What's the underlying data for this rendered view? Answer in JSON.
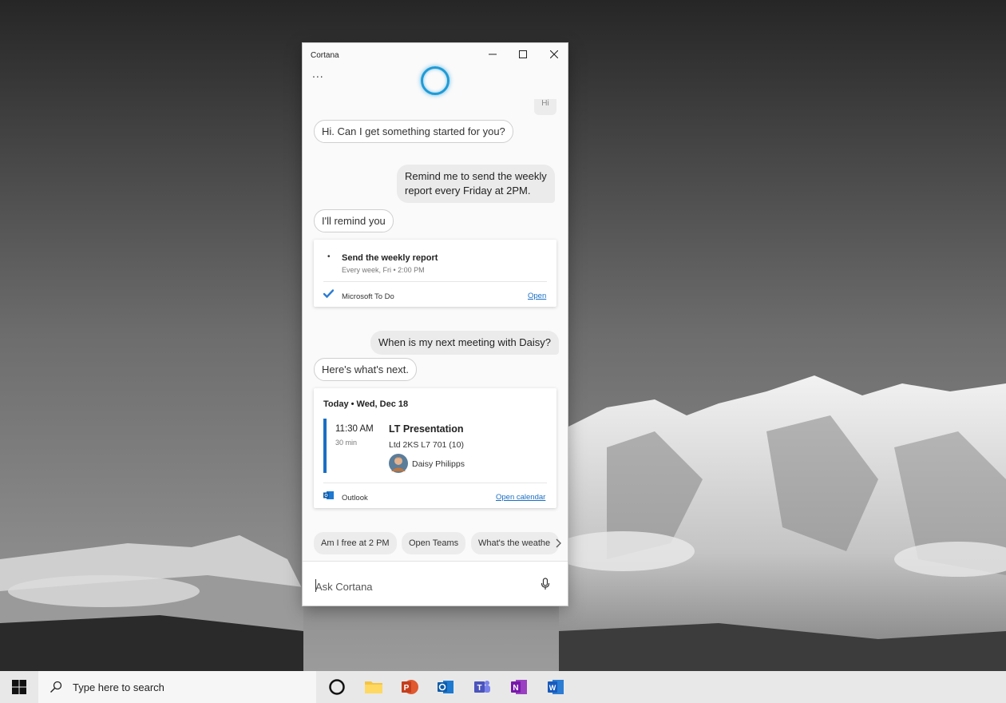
{
  "window": {
    "title": "Cortana",
    "more_label": "...",
    "minimize_label": "—",
    "maximize_label": "☐",
    "close_label": "✕"
  },
  "conversation": {
    "prev_user_message": "Hi",
    "cortana_greeting": "Hi. Can I get something started for you?",
    "user_reminder_request_line1": "Remind me to send the weekly",
    "user_reminder_request_line2": "report every Friday at 2PM.",
    "cortana_remind_reply": "I'll remind you",
    "reminder_card": {
      "bullet": "•",
      "title": "Send the weekly report",
      "subtitle": "Every week, Fri • 2:00 PM",
      "app_name": "Microsoft To Do",
      "action_label": "Open"
    },
    "user_meeting_question": "When is my next meeting with Daisy?",
    "cortana_meeting_reply": "Here's what's next.",
    "meeting_card": {
      "date_header": "Today • Wed, Dec 18",
      "time": "11:30 AM",
      "duration": "30 min",
      "title": "LT Presentation",
      "location": "Ltd 2KS L7 701 (10)",
      "attendee": "Daisy Philipps",
      "app_name": "Outlook",
      "action_label": "Open calendar",
      "accent_color": "#1a6fc4"
    }
  },
  "suggestions": [
    {
      "label": "Am I free at 2 PM"
    },
    {
      "label": "Open Teams"
    },
    {
      "label": "What's the weathe"
    }
  ],
  "input": {
    "placeholder": "Ask Cortana"
  },
  "taskbar": {
    "search_placeholder": "Type here to search",
    "pinned": [
      "cortana",
      "file-explorer",
      "powerpoint",
      "outlook",
      "teams",
      "onenote",
      "word"
    ]
  }
}
